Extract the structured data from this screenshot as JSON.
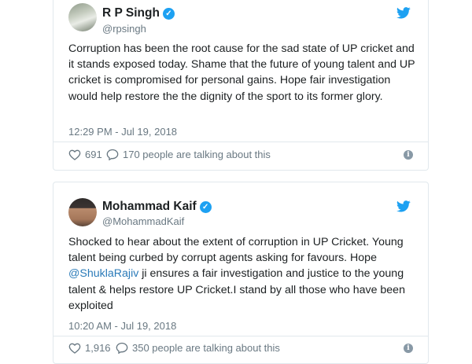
{
  "tweets": [
    {
      "author": {
        "name": "R P Singh",
        "handle": "@rpsingh",
        "verified": true
      },
      "text": "Corruption has been the root cause for the sad state of UP cricket and it stands exposed today. Shame that the future of young talent and UP cricket is compromised for personal gains. Hope fair investigation would help restore the the dignity of the sport to its former glory.",
      "timestamp": "12:29 PM - Jul 19, 2018",
      "likes": "691",
      "talking": "170 people are talking about this"
    },
    {
      "author": {
        "name": "Mohammad Kaif",
        "handle": "@MohammadKaif",
        "verified": true
      },
      "text_before_mention": "Shocked to hear about the extent of corruption in UP Cricket. Young talent being curbed by corrupt agents asking for favours. Hope ",
      "mention": "@ShuklaRajiv",
      "text_after_mention": " ji  ensures a fair investigation and justice to the young talent & helps restore UP Cricket.I stand by all those who have been exploited",
      "timestamp": "10:20 AM - Jul 19, 2018",
      "likes": "1,916",
      "talking": "350 people are talking about this"
    }
  ],
  "colors": {
    "accent": "#1da1f2",
    "link": "#2b7bb9",
    "text": "#1c2022",
    "muted": "#697882",
    "border": "#e1e8ed"
  },
  "icons": {
    "verified": "verified-badge-icon",
    "platform": "twitter-bird-icon",
    "like": "heart-icon",
    "reply": "speech-bubble-icon",
    "info": "info-icon"
  }
}
